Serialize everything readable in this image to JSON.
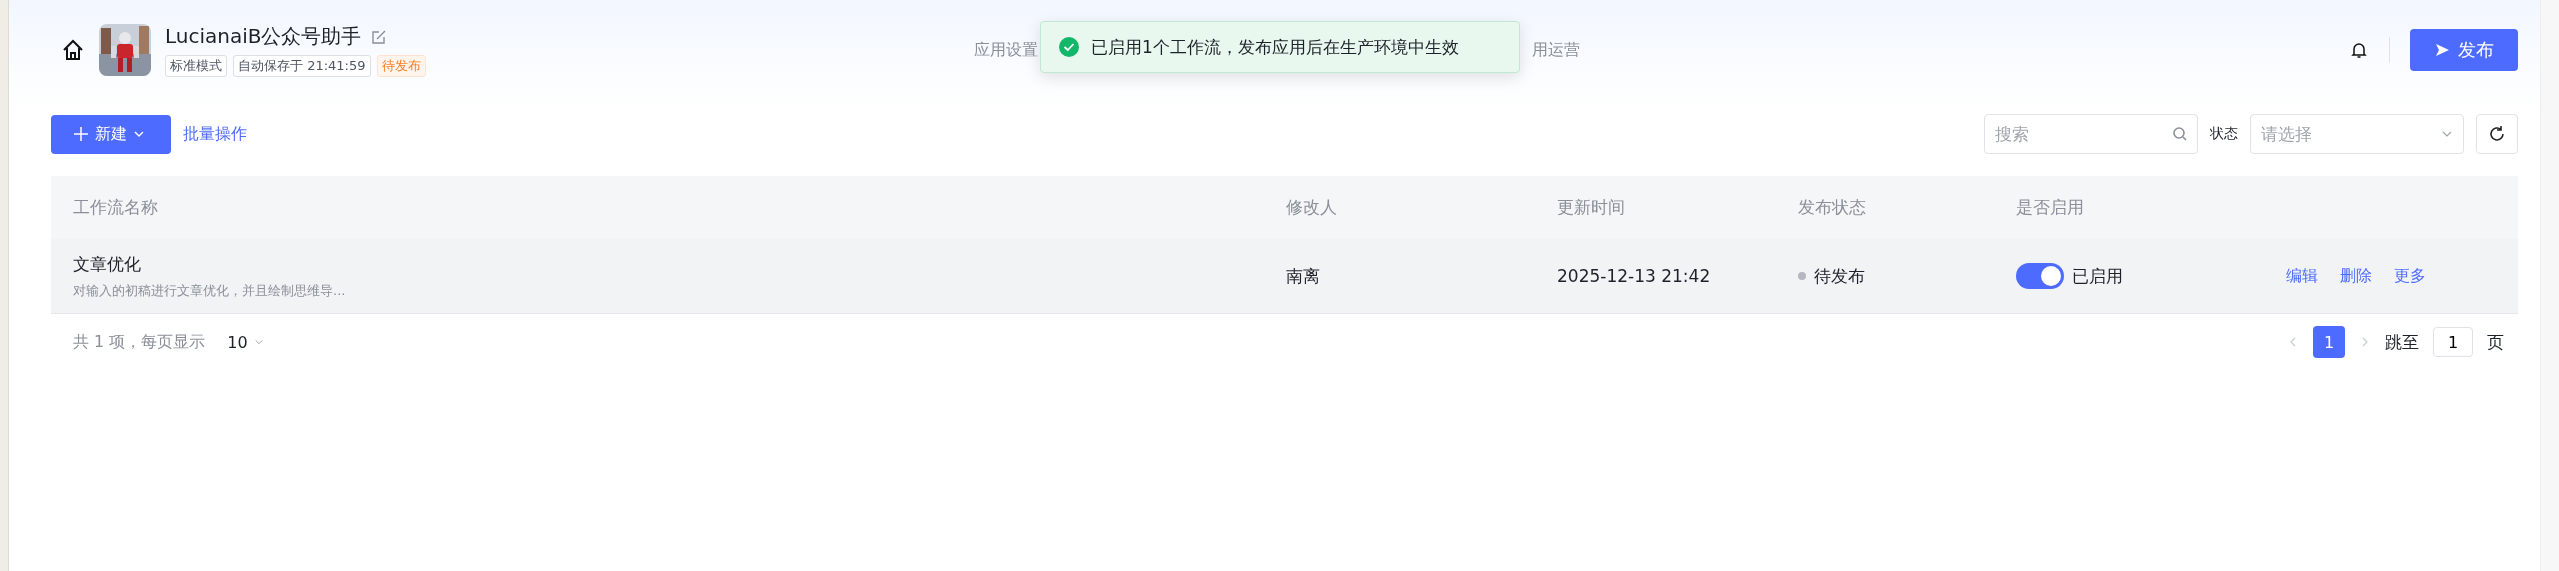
{
  "header": {
    "app_name": "LucianaiB公众号助手",
    "tags": [
      {
        "label": "标准模式",
        "kind": "plain"
      },
      {
        "label": "自动保存于 21:41:59",
        "kind": "plain"
      },
      {
        "label": "待发布",
        "kind": "warning"
      }
    ],
    "nav": [
      "应用设置",
      "用运营"
    ],
    "publish_button": "发布"
  },
  "toast": {
    "kind": "success",
    "message": "已启用1个工作流，发布应用后在生产环境中生效"
  },
  "toolbar": {
    "new_button": "新建",
    "batch_link": "批量操作",
    "search": {
      "placeholder": "搜索"
    },
    "status_label": "状态",
    "status_select": {
      "placeholder": "请选择"
    }
  },
  "table": {
    "columns": [
      "工作流名称",
      "修改人",
      "更新时间",
      "发布状态",
      "是否启用"
    ],
    "rows": [
      {
        "name": "文章优化",
        "description": "对输入的初稿进行文章优化，并且绘制思维导...",
        "modifier": "南离",
        "updated": "2025-12-13 21:42",
        "status": "待发布",
        "color": "#b4b7bf",
        "enabled": true,
        "enabled_label": "已启用",
        "actions": [
          "编辑",
          "删除",
          "更多"
        ]
      }
    ]
  },
  "pagination": {
    "summary": "共 1 项，每页显示",
    "page_size": "10",
    "pages": [
      {
        "label": "1",
        "selected": true
      }
    ],
    "jump_label": "跳至",
    "jump_value": "1",
    "page_unit": "页"
  }
}
